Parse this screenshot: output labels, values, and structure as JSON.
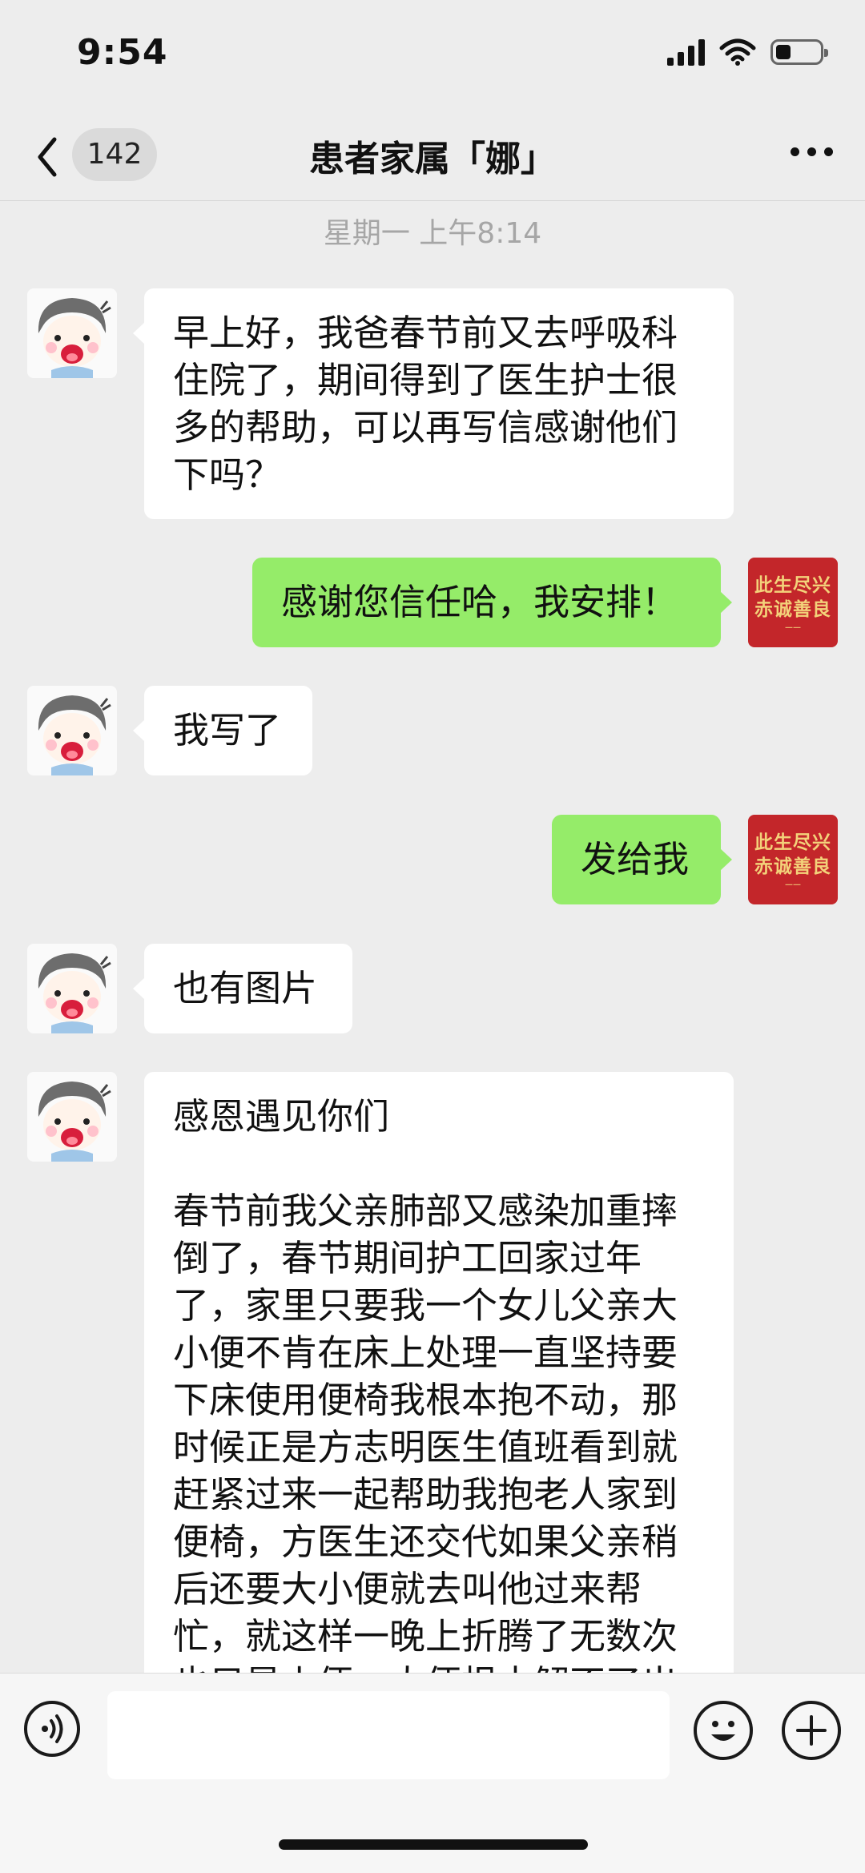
{
  "status_bar": {
    "time": "9:54"
  },
  "nav": {
    "back_count": "142",
    "title": "患者家属「娜」"
  },
  "timestamp": "星期一 上午8:14",
  "avatars": {
    "self_line1": "此生尽兴",
    "self_line2": "赤诚善良"
  },
  "messages": [
    {
      "side": "in",
      "text": "早上好，我爸春节前又去呼吸科住院了，期间得到了医生护士很多的帮助，可以再写信感谢他们下吗？"
    },
    {
      "side": "out",
      "text": "感谢您信任哈，我安排！"
    },
    {
      "side": "in",
      "text": "我写了"
    },
    {
      "side": "out",
      "text": "发给我"
    },
    {
      "side": "in",
      "text": "也有图片"
    },
    {
      "side": "in",
      "title": "感恩遇见你们",
      "body": "春节前我父亲肺部又感染加重摔倒了，春节期间护工回家过年了，家里只要我一个女儿父亲大小便不肯在床上处理一直坚持要下床使用便椅我根本抱不动，那时候正是方志明医生值班看到就赶紧过来一起帮助我抱老人家到便椅，方医生还交代如果父亲稍后还要大小便就去叫他过来帮忙，就这样一晚上折腾了无数次也只是小便，大便根本解不了出"
    }
  ],
  "input": {
    "value": "",
    "placeholder": ""
  },
  "colors": {
    "background": "#ededed",
    "outgoing_bubble": "#95ec69",
    "incoming_bubble": "#ffffff"
  }
}
